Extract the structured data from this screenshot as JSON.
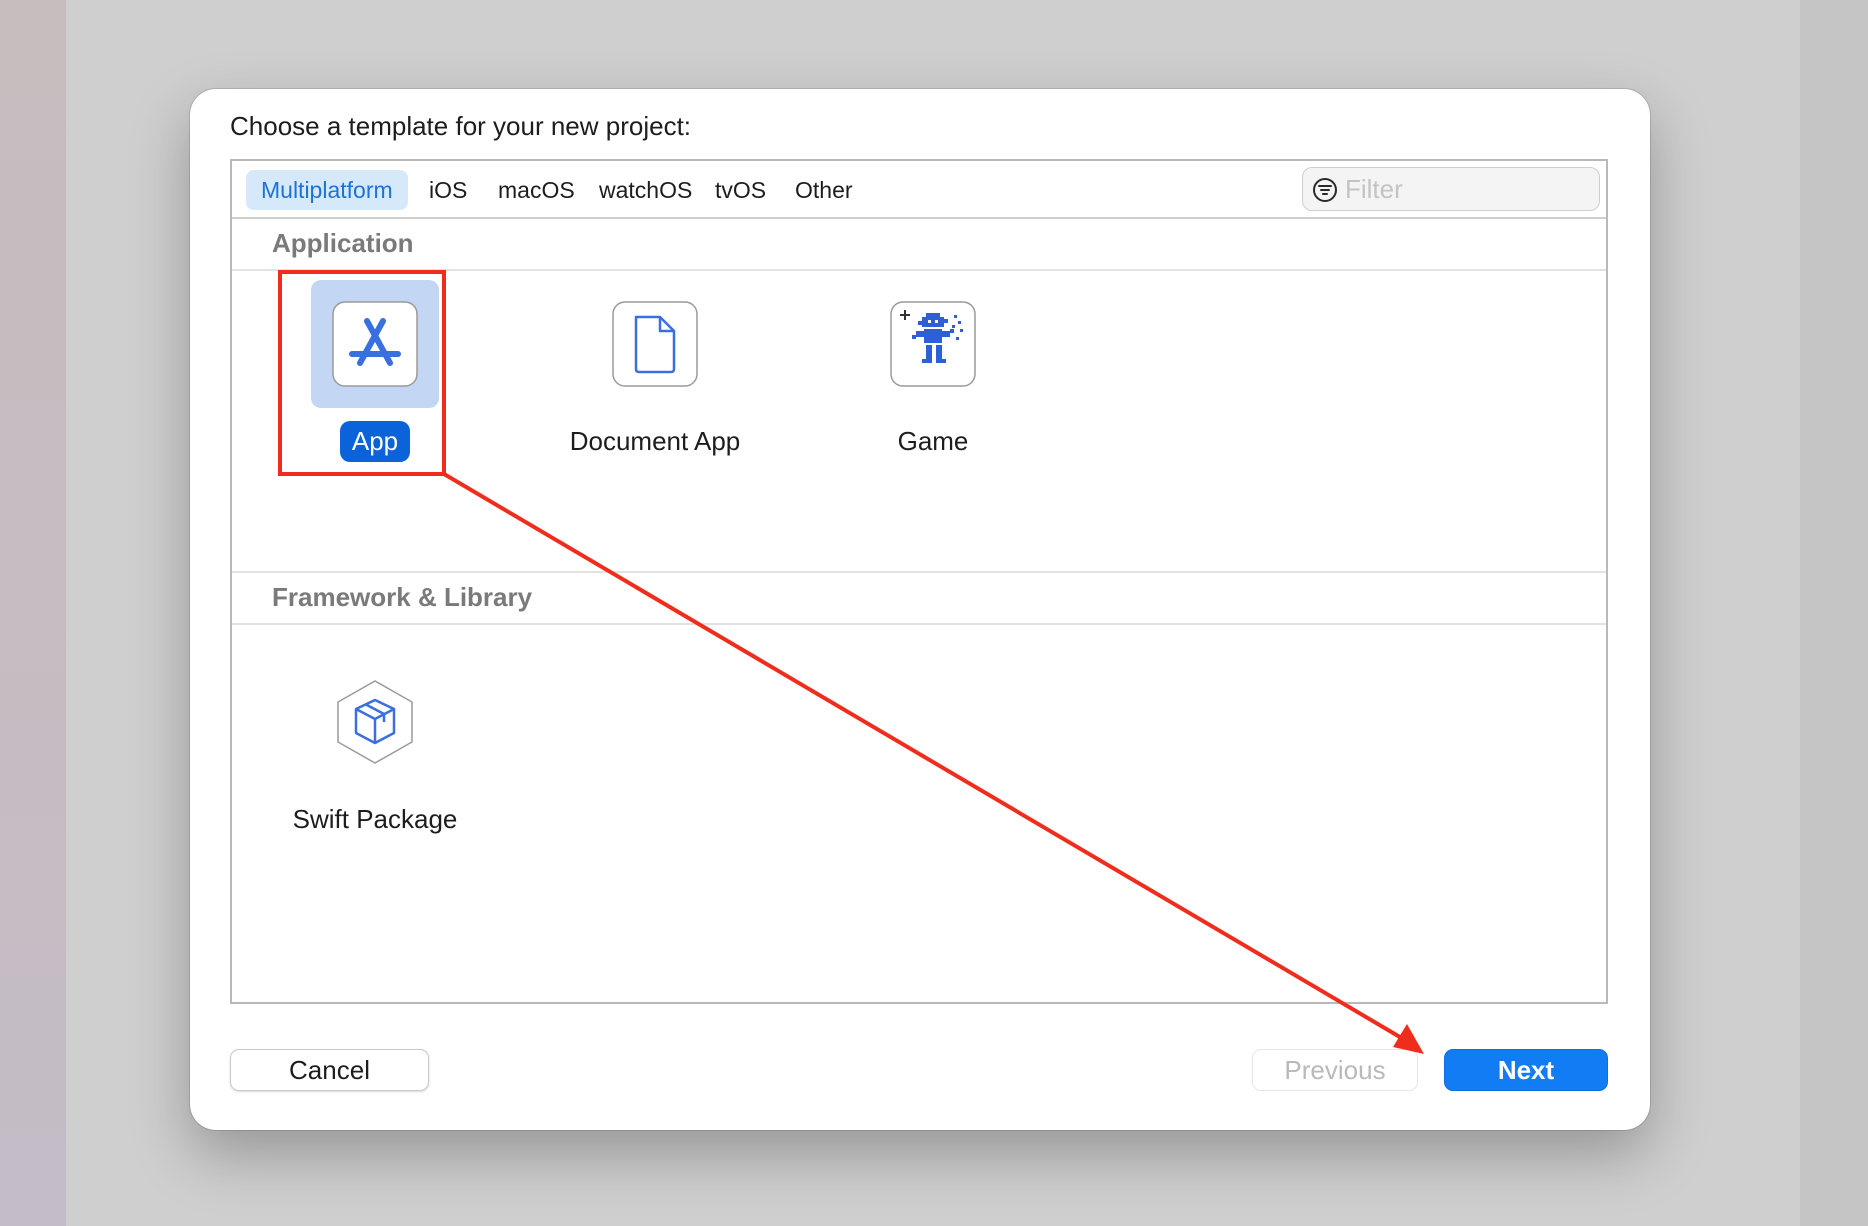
{
  "dialog": {
    "title": "Choose a template for your new project:"
  },
  "tabs": [
    {
      "label": "Multiplatform",
      "selected": true
    },
    {
      "label": "iOS",
      "selected": false
    },
    {
      "label": "macOS",
      "selected": false
    },
    {
      "label": "watchOS",
      "selected": false
    },
    {
      "label": "tvOS",
      "selected": false
    },
    {
      "label": "Other",
      "selected": false
    }
  ],
  "filter": {
    "placeholder": "Filter",
    "value": ""
  },
  "sections": [
    {
      "title": "Application",
      "templates": [
        {
          "label": "App",
          "icon": "app-store-icon",
          "selected": true
        },
        {
          "label": "Document App",
          "icon": "document-icon",
          "selected": false
        },
        {
          "label": "Game",
          "icon": "game-sprite-icon",
          "selected": false
        }
      ]
    },
    {
      "title": "Framework & Library",
      "templates": [
        {
          "label": "Swift Package",
          "icon": "package-box-icon",
          "selected": false
        }
      ]
    }
  ],
  "buttons": {
    "cancel": "Cancel",
    "previous": "Previous",
    "next": "Next"
  },
  "colors": {
    "accent": "#127cf5",
    "selection_fill": "#0b63d9",
    "tab_selected_bg": "#d6e9fb",
    "annotation_red": "#f02d1c"
  }
}
